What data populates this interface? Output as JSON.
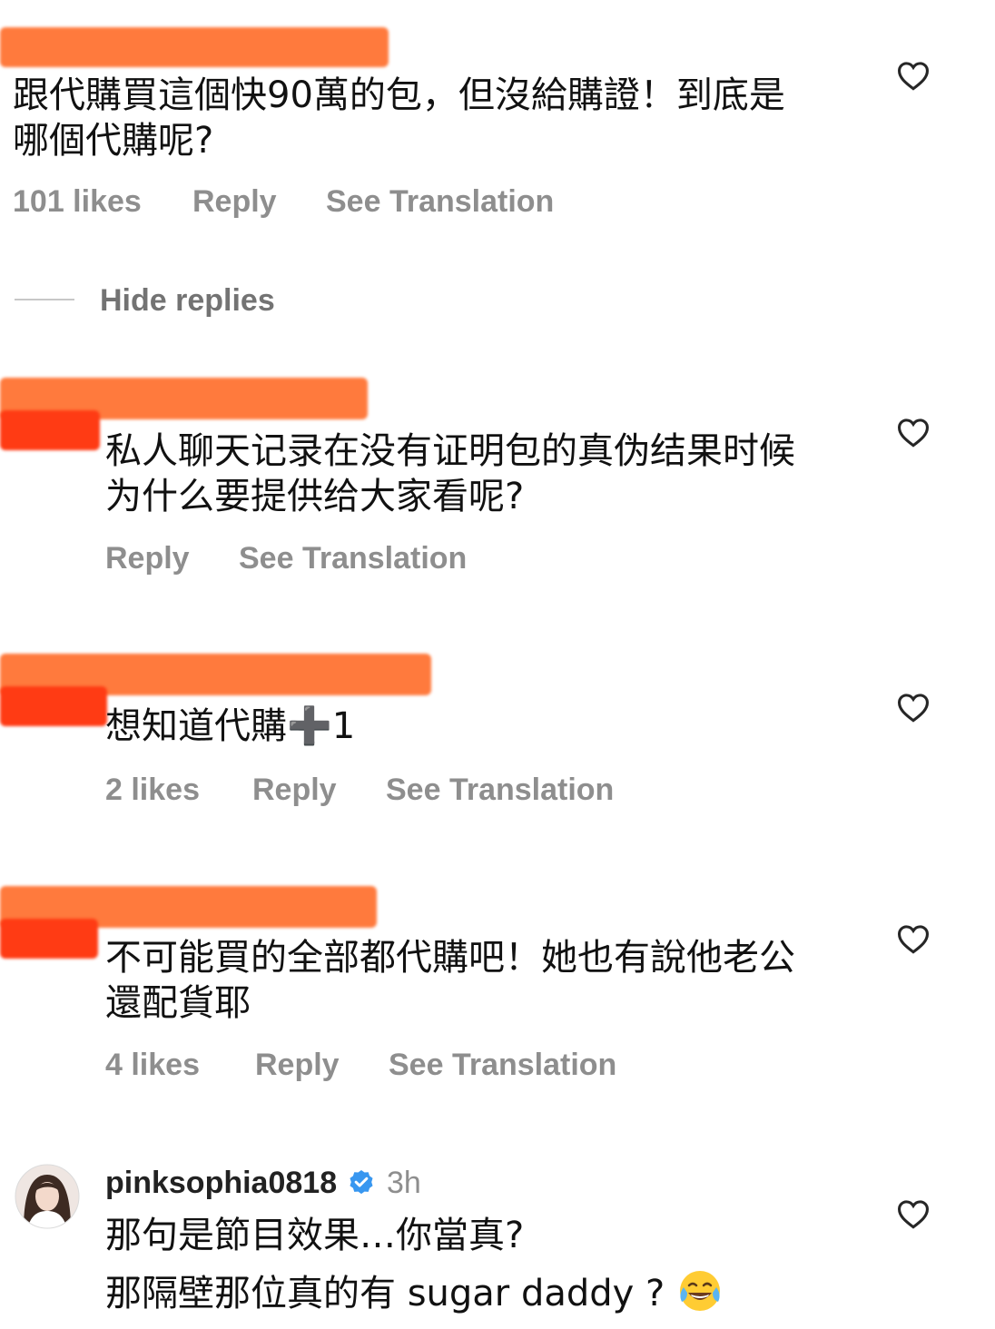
{
  "comments": [
    {
      "text": "跟代購買這個快90萬的包，但沒給購證！到底是哪個代購呢?",
      "likes": "101 likes",
      "reply": "Reply",
      "translate": "See Translation"
    }
  ],
  "hide_replies": "Hide replies",
  "replies": [
    {
      "text": "私人聊天记录在没有证明包的真伪结果时候 为什么要提供给大家看呢?",
      "reply": "Reply",
      "translate": "See Translation"
    },
    {
      "text": "想知道代購➕1",
      "likes": "2 likes",
      "reply": "Reply",
      "translate": "See Translation"
    },
    {
      "text": "不可能買的全部都代購吧！她也有說他老公還配貨耶",
      "likes": "4 likes",
      "reply": "Reply",
      "translate": "See Translation"
    },
    {
      "username": "pinksophia0818",
      "verified": true,
      "time": "3h",
      "line1": "那句是節目效果…你當真?",
      "line2": "那隔壁那位真的有 sugar daddy ?",
      "emoji": "face-with-tears-of-joy"
    }
  ],
  "colors": {
    "redact_orange": "#ff7a3d",
    "redact_red": "#ff3b14",
    "meta_gray": "#8e8e8e",
    "verified_blue": "#3897f0"
  },
  "icons": {
    "like": "heart-outline-icon",
    "verified": "verified-badge-icon"
  }
}
